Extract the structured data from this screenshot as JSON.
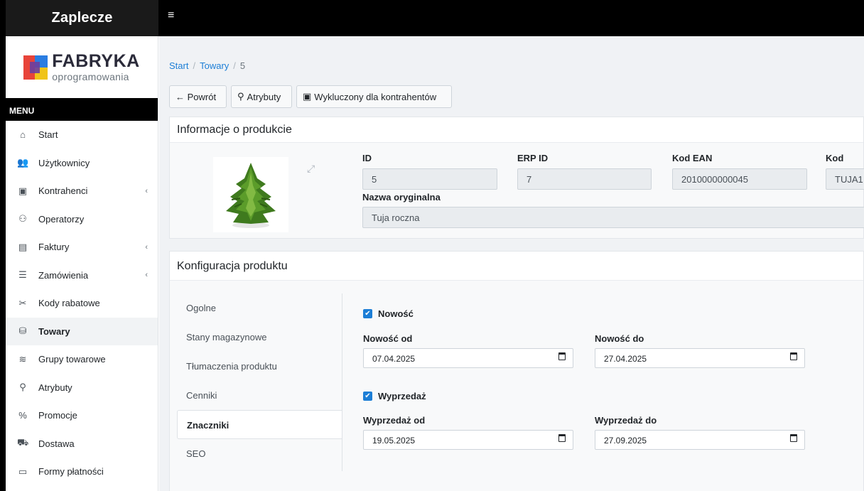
{
  "topbar": {
    "brand": "Zaplecze",
    "hamburger": "≡"
  },
  "logo": {
    "title": "FABRYKA",
    "subtitle": "oprogramowania"
  },
  "sidebar": {
    "header": "MENU",
    "items": [
      {
        "label": "Start",
        "icon": "⌂",
        "chevron": ""
      },
      {
        "label": "Użytkownicy",
        "icon": "👥",
        "chevron": ""
      },
      {
        "label": "Kontrahenci",
        "icon": "▣",
        "chevron": "‹"
      },
      {
        "label": "Operatorzy",
        "icon": "⚇",
        "chevron": ""
      },
      {
        "label": "Faktury",
        "icon": "▤",
        "chevron": "‹"
      },
      {
        "label": "Zamówienia",
        "icon": "☰",
        "chevron": "‹"
      },
      {
        "label": "Kody rabatowe",
        "icon": "✂",
        "chevron": ""
      },
      {
        "label": "Towary",
        "icon": "⛁",
        "chevron": ""
      },
      {
        "label": "Grupy towarowe",
        "icon": "≋",
        "chevron": ""
      },
      {
        "label": "Atrybuty",
        "icon": "⚲",
        "chevron": ""
      },
      {
        "label": "Promocje",
        "icon": "%",
        "chevron": ""
      },
      {
        "label": "Dostawa",
        "icon": "⛟",
        "chevron": ""
      },
      {
        "label": "Formy płatności",
        "icon": "▭",
        "chevron": ""
      }
    ]
  },
  "breadcrumb": {
    "start": "Start",
    "towary": "Towary",
    "current": "5",
    "sep": "/"
  },
  "toolbar": {
    "back": "← Powrót",
    "attrs": "Atrybuty",
    "attrs_icon": "⚲",
    "excluded": "Wykluczony dla kontrahentów",
    "excluded_icon": "▣"
  },
  "info": {
    "title": "Informacje o produkcie",
    "expand_icon": "⤢",
    "fields": {
      "id_label": "ID",
      "id_value": "5",
      "erp_label": "ERP ID",
      "erp_value": "7",
      "ean_label": "Kod EAN",
      "ean_value": "2010000000045",
      "kod_label": "Kod",
      "kod_value": "TUJA1",
      "name_label": "Nazwa oryginalna",
      "name_value": "Tuja roczna"
    }
  },
  "config": {
    "title": "Konfiguracja produktu",
    "tabs": [
      "Ogolne",
      "Stany magazynowe",
      "Tłumaczenia produktu",
      "Cenniki",
      "Znaczniki",
      "SEO"
    ],
    "active_tab": "Znaczniki",
    "nowosc": {
      "check_label": "Nowość",
      "checked": true,
      "from_label": "Nowość od",
      "from_value": "07.04.2025",
      "to_label": "Nowość do",
      "to_value": "27.04.2025"
    },
    "wyprzedaz": {
      "check_label": "Wyprzedaż",
      "checked": true,
      "from_label": "Wyprzedaż od",
      "from_value": "19.05.2025",
      "to_label": "Wyprzedaż do",
      "to_value": "27.09.2025"
    }
  },
  "colors": {
    "accent": "#1c7ed6",
    "topbar": "#000000",
    "sidebar_active": "#f1f3f5"
  }
}
